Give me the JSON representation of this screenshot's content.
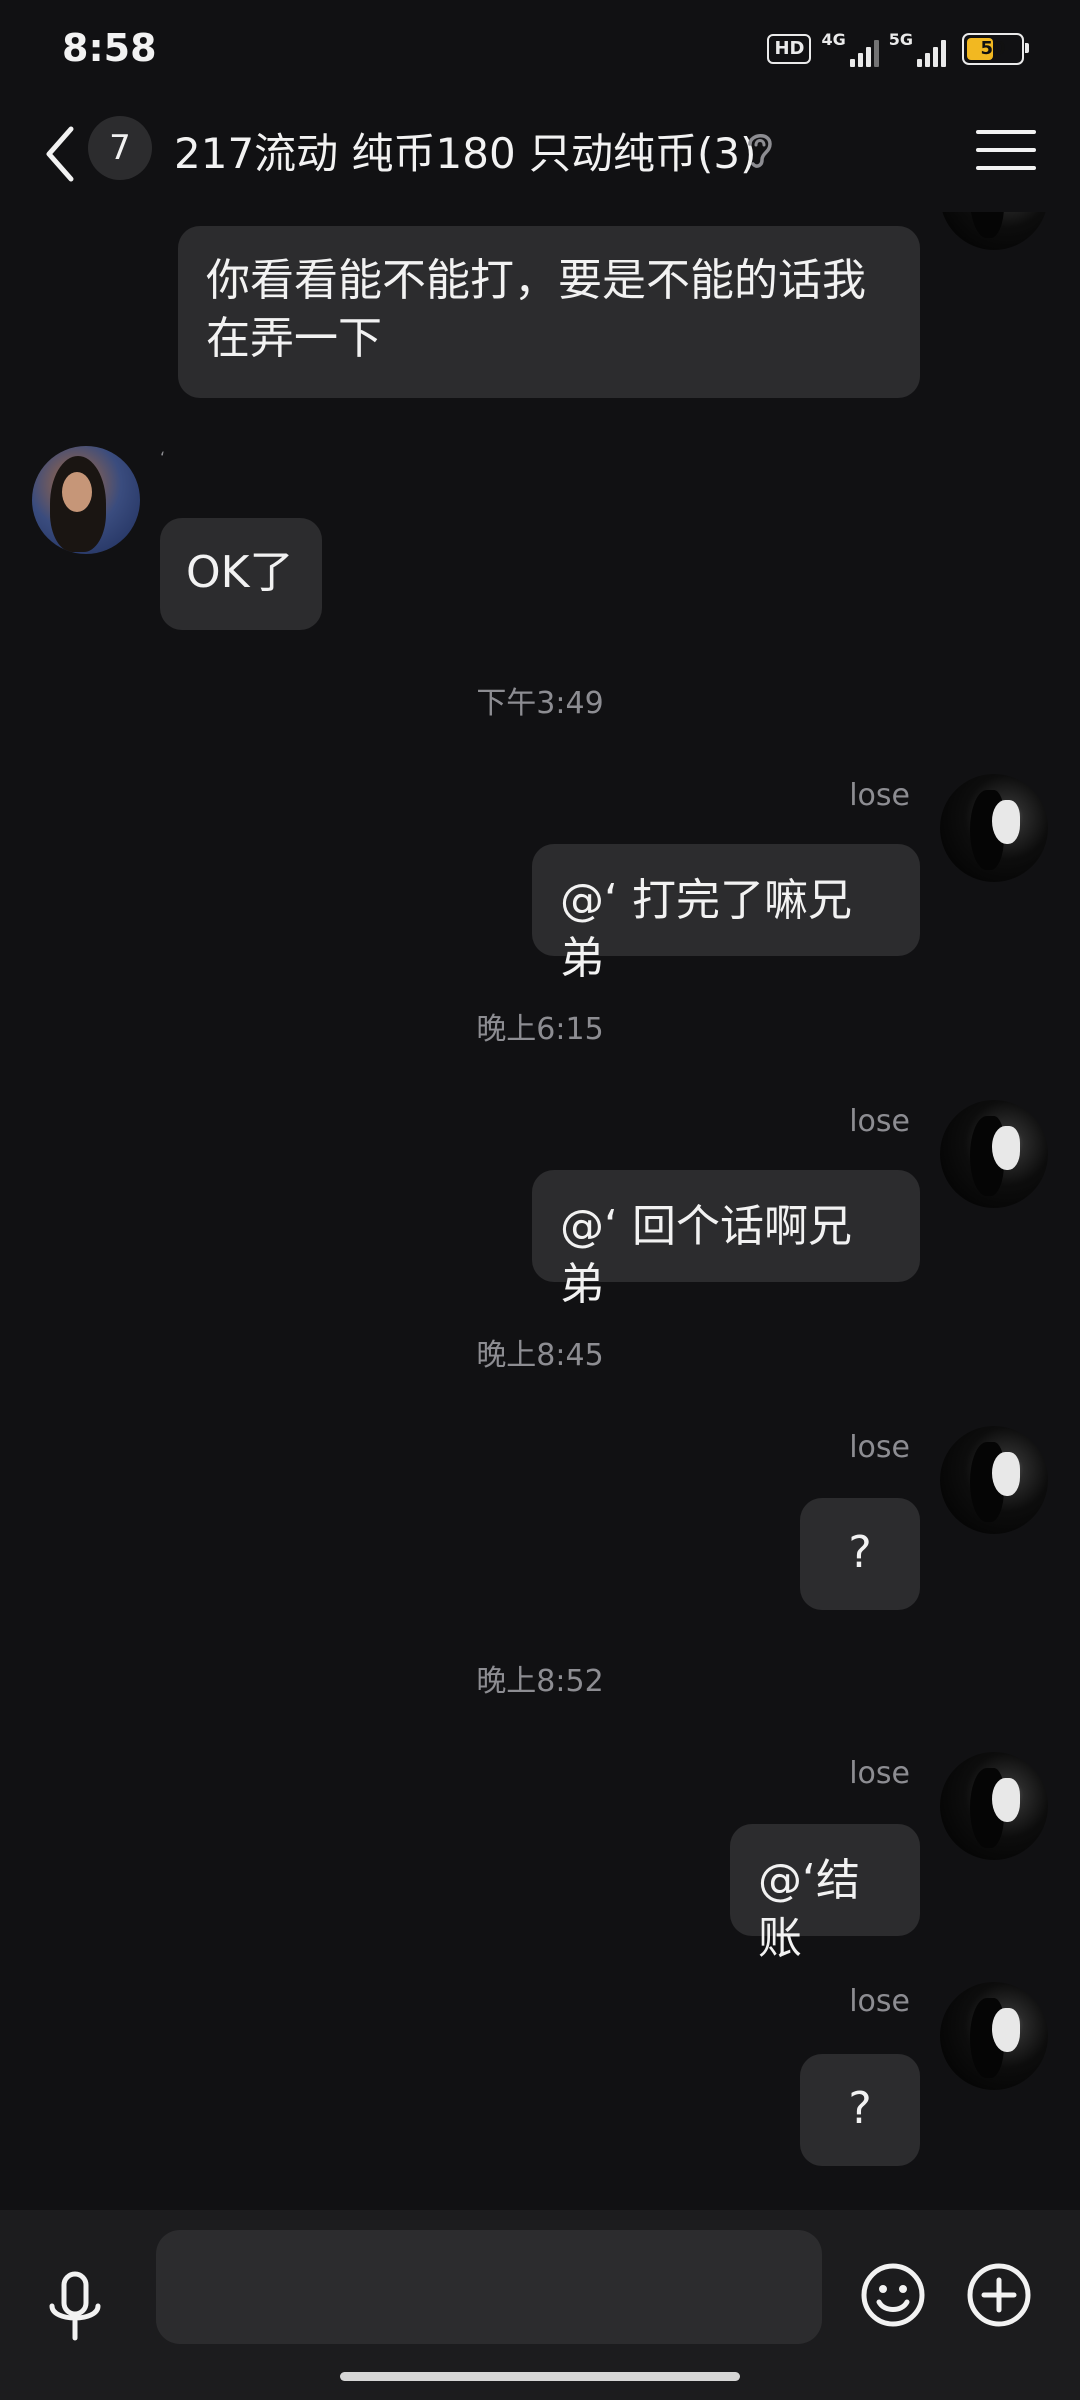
{
  "status_bar": {
    "time": "8:58",
    "hd_label": "HD",
    "network_1": "4G",
    "network_2": "5G",
    "battery": "50"
  },
  "header": {
    "unread_count": "7",
    "title": "217流动 纯币180 只动纯币(3)"
  },
  "messages": [
    {
      "sender": "me",
      "name": "",
      "text": "你看看能不能打，要是不能的话我\n在弄一下"
    },
    {
      "sender": "other",
      "name": "‘",
      "text": "OK了"
    },
    {
      "sender": "me",
      "name": "lose",
      "text": "@‘ 打完了嘛兄弟",
      "time": "下午3:49"
    },
    {
      "sender": "me",
      "name": "lose",
      "text": "@‘ 回个话啊兄弟",
      "time": "晚上6:15"
    },
    {
      "sender": "me",
      "name": "lose",
      "text": "?",
      "time": "晚上8:45"
    },
    {
      "sender": "me",
      "name": "lose",
      "text": "@‘结账",
      "time": "晚上8:52"
    },
    {
      "sender": "me",
      "name": "lose",
      "text": "?"
    }
  ],
  "input": {
    "value": "",
    "placeholder": ""
  },
  "icons": {
    "back": "chevron-left-icon",
    "listen": "ear-icon",
    "menu": "menu-icon",
    "mic": "microphone-icon",
    "emoji": "smiley-icon",
    "plus": "plus-circle-icon"
  },
  "colors": {
    "background": "#111113",
    "bubble": "#2c2c2e",
    "input_bar": "#1c1c1e",
    "battery": "#f2b821"
  }
}
